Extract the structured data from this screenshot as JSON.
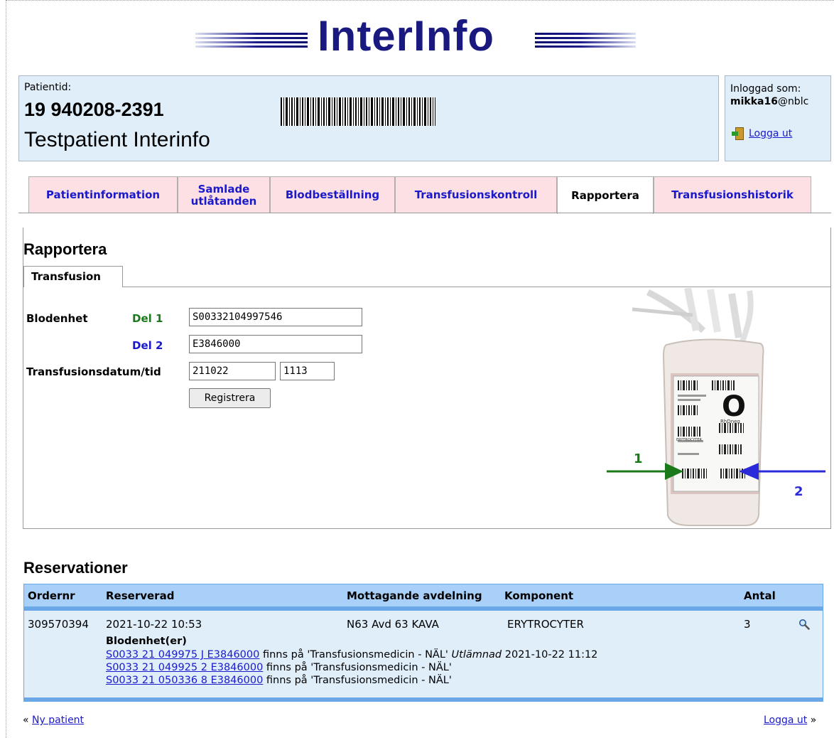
{
  "app": {
    "logo_text": "InterInfo"
  },
  "patient": {
    "label": "Patientid:",
    "id": "19 940208-2391",
    "name": "Testpatient Interinfo"
  },
  "login": {
    "label": "Inloggad som:",
    "user": "mikka16",
    "domain": "@nblc",
    "logout": "Logga ut"
  },
  "tabs": [
    {
      "label": "Patientinformation",
      "active": false
    },
    {
      "label": "Samlade utlåtanden",
      "active": false
    },
    {
      "label": "Blodbeställning",
      "active": false
    },
    {
      "label": "Transfusionskontroll",
      "active": false
    },
    {
      "label": "Rapportera",
      "active": true
    },
    {
      "label": "Transfusionshistorik",
      "active": false
    }
  ],
  "report": {
    "heading": "Rapportera",
    "subtab": "Transfusion",
    "blodenhet_label": "Blodenhet",
    "del1_label": "Del 1",
    "del1_value": "S00332104997546",
    "del2_label": "Del 2",
    "del2_value": "E3846000",
    "datetime_label": "Transfusionsdatum/tid",
    "date_value": "211022",
    "time_value": "1113",
    "submit_label": "Registrera",
    "bag": {
      "blood_group": "O",
      "rh": "RhDneg",
      "component": "ERYTROCYTER",
      "marker1": "1",
      "marker2": "2"
    }
  },
  "reservations": {
    "heading": "Reservationer",
    "columns": [
      "Ordernr",
      "Reserverad",
      "Mottagande avdelning",
      "Komponent",
      "Antal"
    ],
    "row": {
      "ordernr": "309570394",
      "reserved": "2021-10-22 10:53",
      "department": "N63 Avd 63 KAVA",
      "component": "ERYTROCYTER",
      "count": "3"
    },
    "units_label": "Blodenhet(er)",
    "units": [
      {
        "link": "S0033 21 049975 J E3846000",
        "text": " finns på 'Transfusionsmedicin - NÄL' ",
        "status": "Utlämnad",
        "time": " 2021-10-22 11:12"
      },
      {
        "link": "S0033 21 049925 2 E3846000",
        "text": " finns på 'Transfusionsmedicin - NÄL'",
        "status": "",
        "time": ""
      },
      {
        "link": "S0033 21 050336 8 E3846000",
        "text": " finns på 'Transfusionsmedicin - NÄL'",
        "status": "",
        "time": ""
      }
    ]
  },
  "footer": {
    "new_patient": "Ny patient",
    "logout": "Logga ut"
  },
  "colors": {
    "logo": "#191980",
    "info_bg": "#e0eefa",
    "tab_bg": "#fde0e4",
    "link": "#1a1acc",
    "table_head": "#a8d0f8",
    "del1": "#1a7a1a",
    "del2": "#1a1acc",
    "marker_green": "#1a7a1a",
    "marker_blue": "#2a2ad8"
  }
}
